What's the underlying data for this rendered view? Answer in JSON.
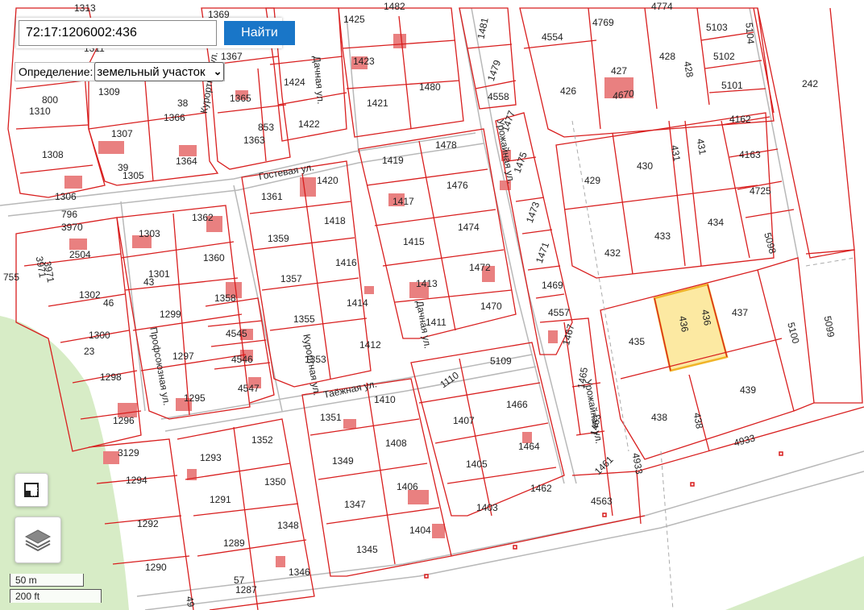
{
  "search": {
    "value": "72:17:1206002:436",
    "button_label": "Найти"
  },
  "definition": {
    "label": "Определение:",
    "selected": "земельный участок"
  },
  "controls": {
    "measure_icon": "ruler-icon",
    "layers_icon": "layers-icon"
  },
  "scale": {
    "metric": "50 m",
    "imperial": "200 ft"
  },
  "colors": {
    "boundary": "#d81e1e",
    "selected_fill": "#fce9a2",
    "selected_stroke": "#f0b428",
    "selected_text": "#e07a20",
    "building": "#e98080",
    "greenery": "#d7ecc6"
  },
  "selected_parcel": "436",
  "streets": [
    "Дачная ул.",
    "Гостевая ул.",
    "Курортная ул.",
    "Урожайная ул.",
    "Профсоюзная ул.",
    "Таёжная ул."
  ],
  "parcels": [
    "1313",
    "1369",
    "1425",
    "1482",
    "1481",
    "4554",
    "4769",
    "4774",
    "5103",
    "5104",
    "242",
    "1311",
    "1367",
    "1423",
    "1479",
    "426",
    "427",
    "4670",
    "428",
    "5102",
    "5101",
    "1310",
    "800",
    "1309",
    "38",
    "1365",
    "1424",
    "1480",
    "4558",
    "1421",
    "1366",
    "853",
    "1422",
    "1477",
    "4162",
    "1308",
    "1307",
    "1363",
    "1478",
    "431",
    "1475",
    "429",
    "430",
    "4163",
    "39",
    "1305",
    "1364",
    "1419",
    "4725",
    "1306",
    "1361",
    "1420",
    "1476",
    "1473",
    "796",
    "3970",
    "1303",
    "1362",
    "1418",
    "1417",
    "1474",
    "432",
    "433",
    "434",
    "5098",
    "2504",
    "1359",
    "1415",
    "1471",
    "3971",
    "1301",
    "43",
    "1360",
    "1416",
    "1472",
    "755",
    "1302",
    "1357",
    "1413",
    "1469",
    "46",
    "1358",
    "1414",
    "1470",
    "4557",
    "437",
    "1299",
    "1300",
    "1355",
    "1411",
    "435",
    "436",
    "5100",
    "5099",
    "4545",
    "1412",
    "1467",
    "23",
    "1297",
    "4546",
    "1353",
    "4547",
    "1298",
    "1295",
    "1110",
    "5109",
    "1465",
    "439",
    "1410",
    "1466",
    "1296",
    "1351",
    "1407",
    "438",
    "1408",
    "1464",
    "1463",
    "4933",
    "3129",
    "1293",
    "1352",
    "1349",
    "1405",
    "1294",
    "1291",
    "1350",
    "1406",
    "1462",
    "1461",
    "4563",
    "1347",
    "1403",
    "1292",
    "1348",
    "1404",
    "1289",
    "1345",
    "1290",
    "1346",
    "57",
    "1287",
    "49"
  ]
}
